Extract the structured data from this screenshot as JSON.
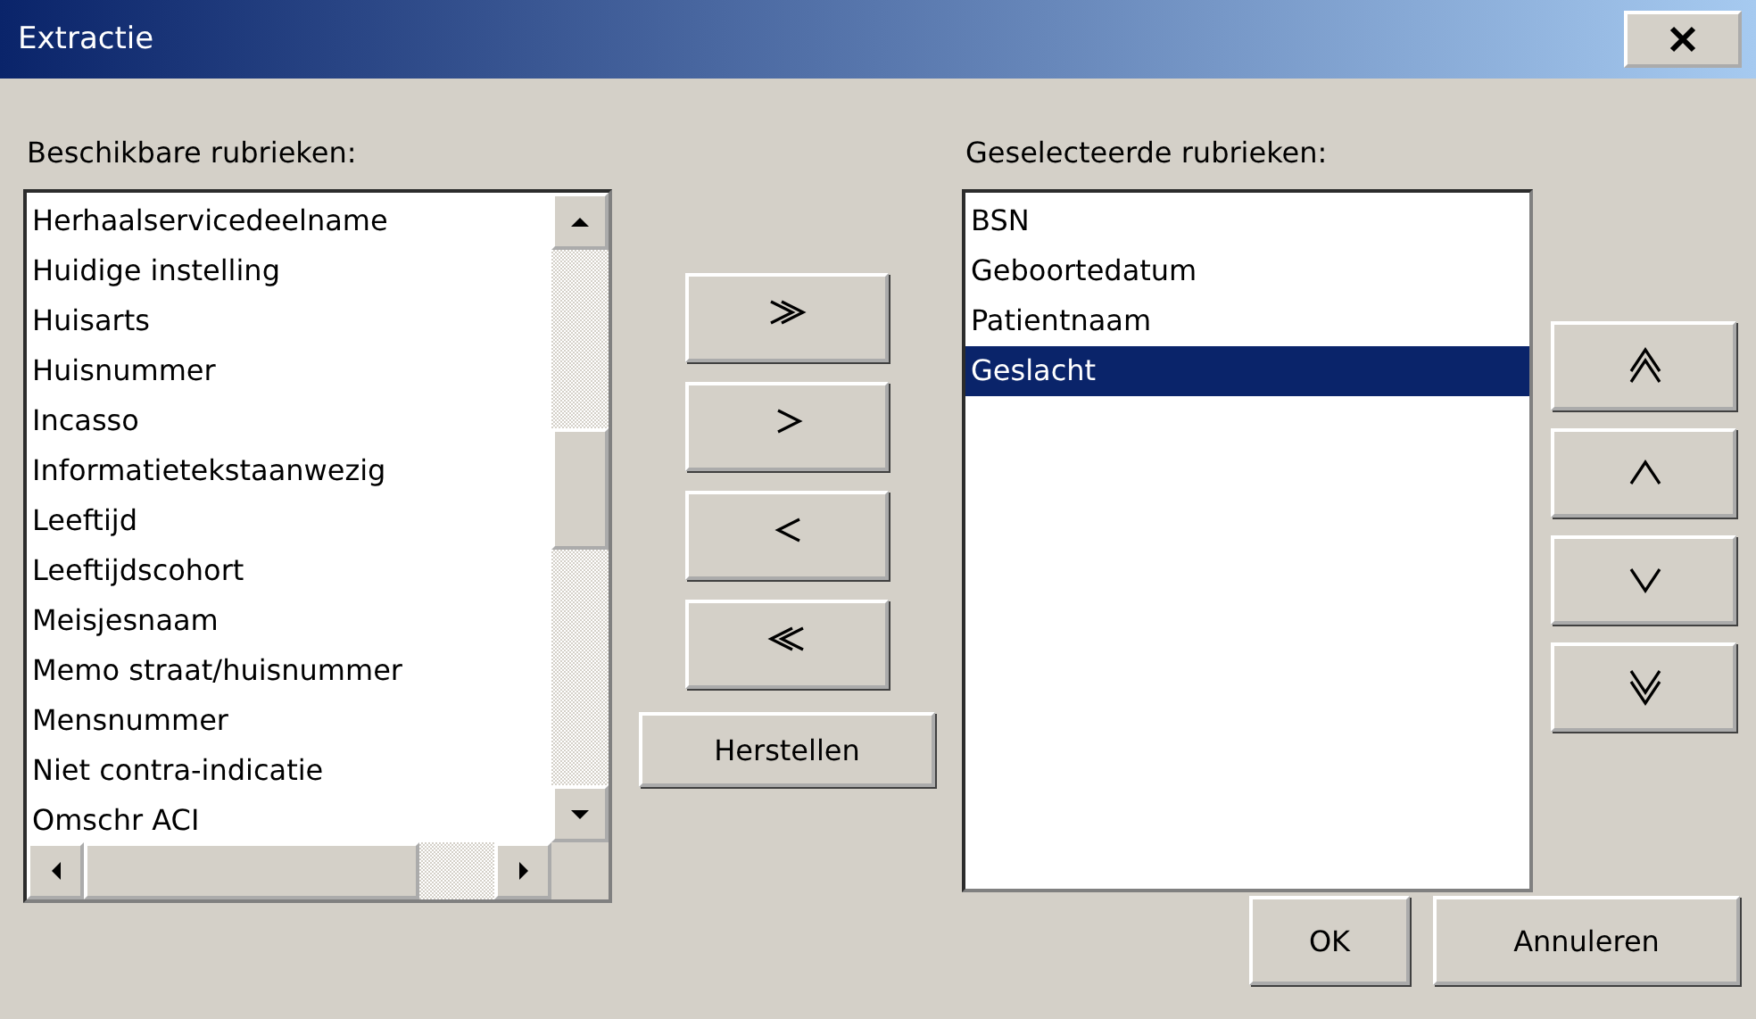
{
  "window": {
    "title": "Extractie"
  },
  "available": {
    "label": "Beschikbare rubrieken:",
    "items": [
      {
        "label": "Herhaalservicedeelname",
        "selected": false
      },
      {
        "label": "Huidige instelling",
        "selected": false
      },
      {
        "label": "Huisarts",
        "selected": false
      },
      {
        "label": "Huisnummer",
        "selected": false
      },
      {
        "label": "Incasso",
        "selected": false
      },
      {
        "label": "Informatietekstaanwezig",
        "selected": false
      },
      {
        "label": "Leeftijd",
        "selected": false
      },
      {
        "label": "Leeftijdscohort",
        "selected": false
      },
      {
        "label": "Meisjesnaam",
        "selected": false
      },
      {
        "label": "Memo straat/huisnummer",
        "selected": false
      },
      {
        "label": "Mensnummer",
        "selected": false
      },
      {
        "label": "Niet contra-indicatie",
        "selected": false
      },
      {
        "label": "Omschr ACI",
        "selected": false
      }
    ]
  },
  "transfer_buttons": [
    {
      "kind": "add-all"
    },
    {
      "kind": "add"
    },
    {
      "kind": "remove"
    },
    {
      "kind": "remove-all"
    },
    {
      "kind": "text",
      "label": "Herstellen"
    }
  ],
  "selected_list": {
    "label": "Geselecteerde rubrieken:",
    "items": [
      {
        "label": "BSN",
        "selected": false
      },
      {
        "label": "Geboortedatum",
        "selected": false
      },
      {
        "label": "Patientnaam",
        "selected": false
      },
      {
        "label": "Geslacht",
        "selected": true
      }
    ]
  },
  "order_buttons": [
    {
      "kind": "top"
    },
    {
      "kind": "up"
    },
    {
      "kind": "down"
    },
    {
      "kind": "bottom"
    }
  ],
  "buttons": [
    "OK",
    "Annuleren"
  ]
}
